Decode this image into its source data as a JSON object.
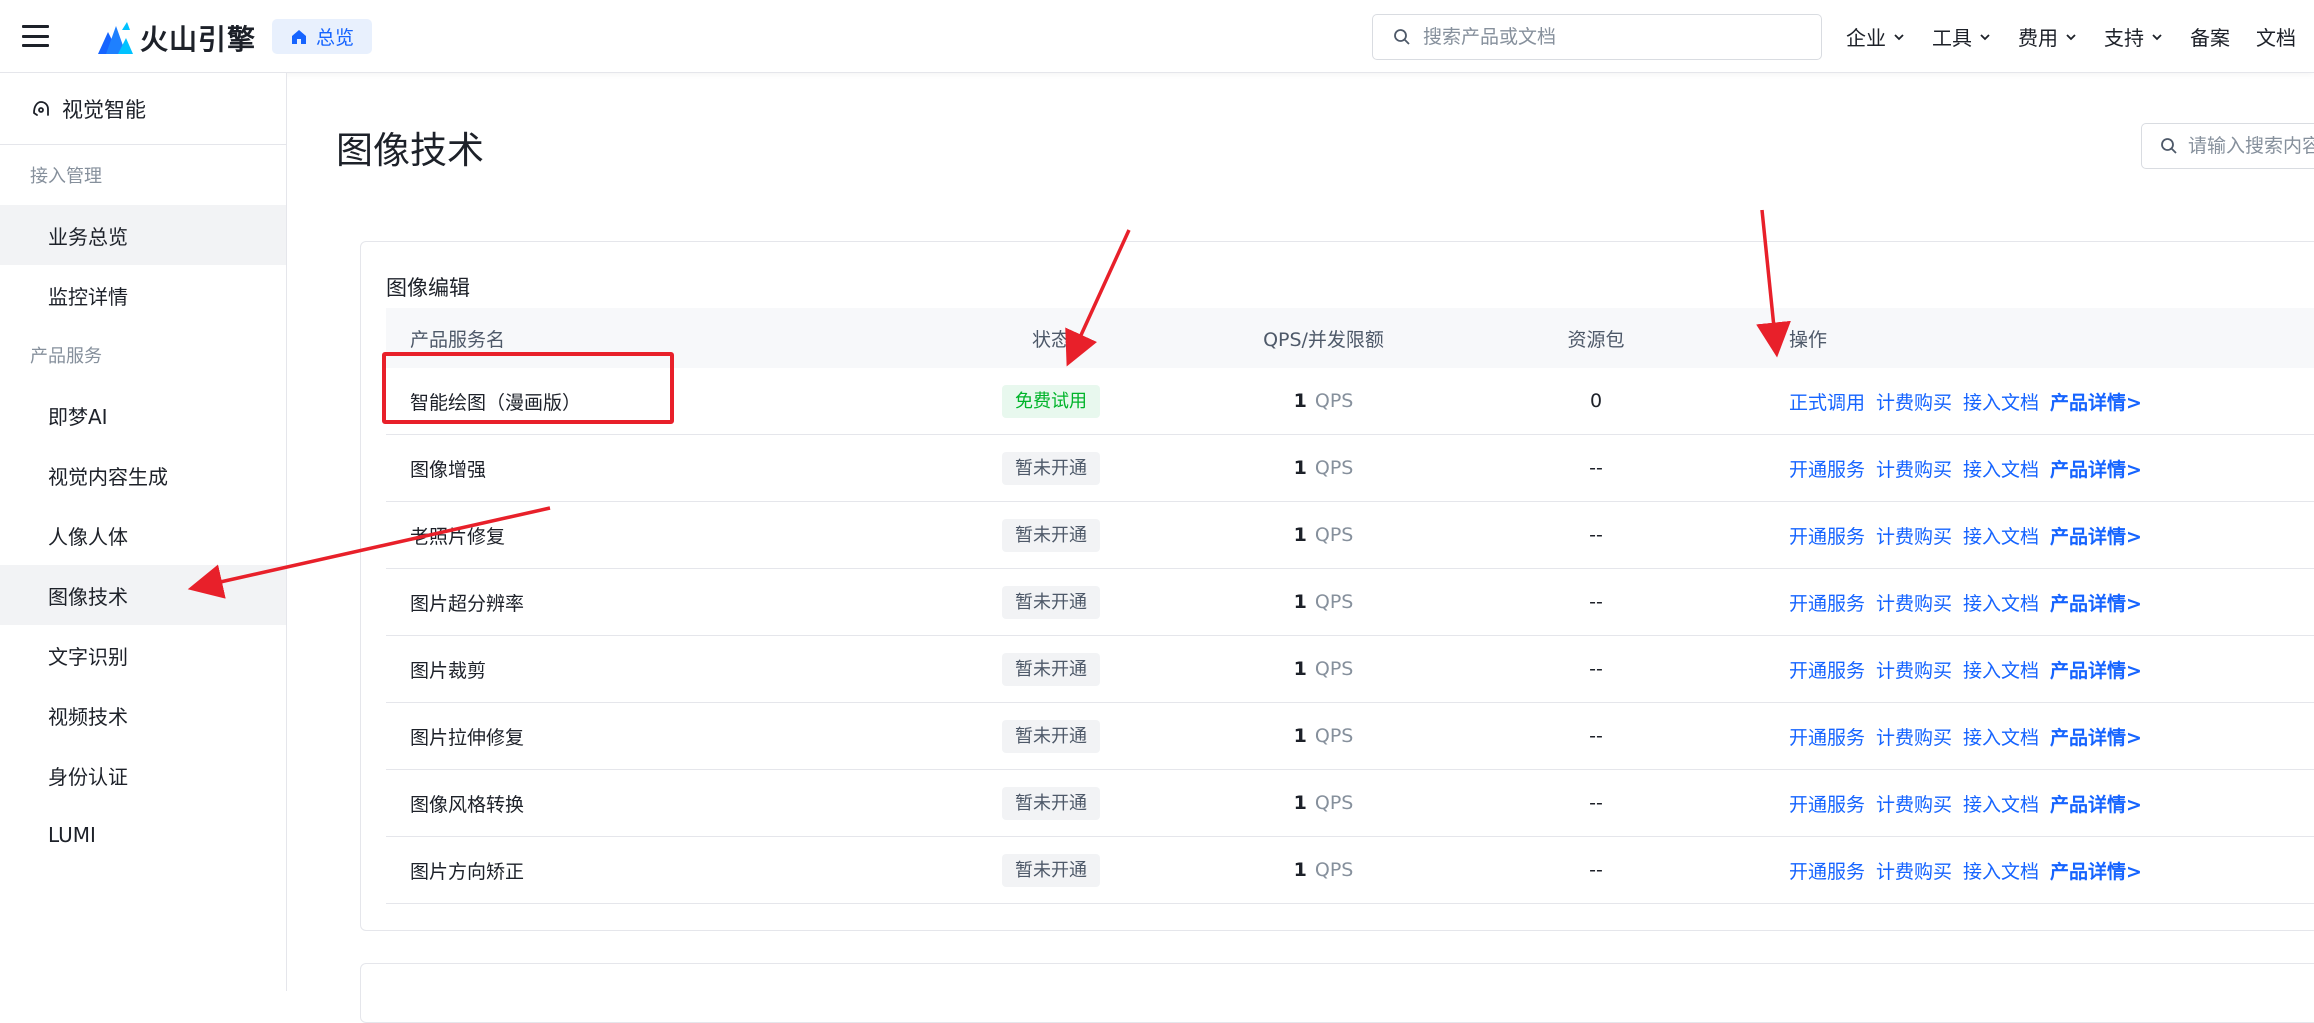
{
  "header": {
    "brand": "火山引擎",
    "overview_chip": "总览",
    "search_placeholder": "搜索产品或文档",
    "nav": [
      {
        "label": "企业",
        "dropdown": true
      },
      {
        "label": "工具",
        "dropdown": true
      },
      {
        "label": "费用",
        "dropdown": true
      },
      {
        "label": "支持",
        "dropdown": true
      },
      {
        "label": "备案",
        "dropdown": false
      },
      {
        "label": "文档",
        "dropdown": false
      }
    ]
  },
  "sidebar": {
    "title": "视觉智能",
    "groups": [
      {
        "label": "接入管理",
        "items": [
          "业务总览",
          "监控详情"
        ]
      },
      {
        "label": "产品服务",
        "items": [
          "即梦AI",
          "视觉内容生成",
          "人像人体",
          "图像技术",
          "文字识别",
          "视频技术",
          "身份认证",
          "LUMI"
        ]
      }
    ],
    "active_item": "图像技术"
  },
  "main": {
    "title": "图像技术",
    "search_placeholder": "请输入搜索内容",
    "section": {
      "title": "图像编辑",
      "columns": [
        "产品服务名",
        "状态",
        "QPS/并发限额",
        "资源包",
        "操作"
      ],
      "rows": [
        {
          "name": "智能绘图（漫画版）",
          "status": "免费试用",
          "status_type": "trial",
          "qps": "1",
          "qps_unit": "QPS",
          "pack": "0",
          "ops": [
            "正式调用",
            "计费购买",
            "接入文档",
            "产品详情>"
          ]
        },
        {
          "name": "图像增强",
          "status": "暂未开通",
          "status_type": "off",
          "qps": "1",
          "qps_unit": "QPS",
          "pack": "--",
          "ops": [
            "开通服务",
            "计费购买",
            "接入文档",
            "产品详情>"
          ]
        },
        {
          "name": "老照片修复",
          "status": "暂未开通",
          "status_type": "off",
          "qps": "1",
          "qps_unit": "QPS",
          "pack": "--",
          "ops": [
            "开通服务",
            "计费购买",
            "接入文档",
            "产品详情>"
          ]
        },
        {
          "name": "图片超分辨率",
          "status": "暂未开通",
          "status_type": "off",
          "qps": "1",
          "qps_unit": "QPS",
          "pack": "--",
          "ops": [
            "开通服务",
            "计费购买",
            "接入文档",
            "产品详情>"
          ]
        },
        {
          "name": "图片裁剪",
          "status": "暂未开通",
          "status_type": "off",
          "qps": "1",
          "qps_unit": "QPS",
          "pack": "--",
          "ops": [
            "开通服务",
            "计费购买",
            "接入文档",
            "产品详情>"
          ]
        },
        {
          "name": "图片拉伸修复",
          "status": "暂未开通",
          "status_type": "off",
          "qps": "1",
          "qps_unit": "QPS",
          "pack": "--",
          "ops": [
            "开通服务",
            "计费购买",
            "接入文档",
            "产品详情>"
          ]
        },
        {
          "name": "图像风格转换",
          "status": "暂未开通",
          "status_type": "off",
          "qps": "1",
          "qps_unit": "QPS",
          "pack": "--",
          "ops": [
            "开通服务",
            "计费购买",
            "接入文档",
            "产品详情>"
          ]
        },
        {
          "name": "图片方向矫正",
          "status": "暂未开通",
          "status_type": "off",
          "qps": "1",
          "qps_unit": "QPS",
          "pack": "--",
          "ops": [
            "开通服务",
            "计费购买",
            "接入文档",
            "产品详情>"
          ]
        }
      ]
    }
  },
  "colors": {
    "accent": "#1664ff",
    "trial_text": "#00b42a",
    "trial_bg": "#e8f8ee",
    "annotation": "#e8202a"
  }
}
